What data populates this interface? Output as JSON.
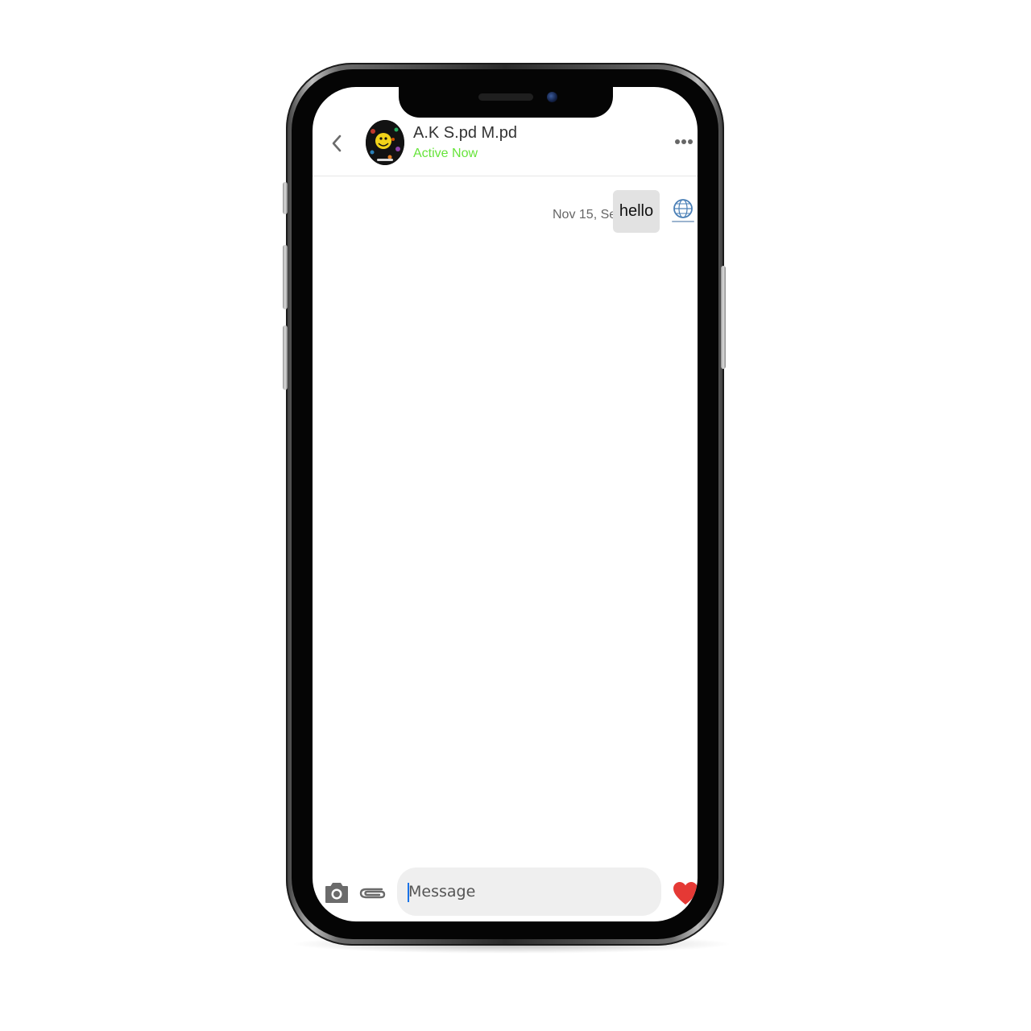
{
  "chat": {
    "contact_name": "A.K S.pd M.pd",
    "contact_status": "Active Now",
    "messages": [
      {
        "time": "Nov 15, Sel",
        "text": "hello",
        "from_self": true
      }
    ]
  },
  "composer": {
    "placeholder": "Message",
    "value": ""
  },
  "icons": {
    "back": "chevron-left-icon",
    "more": "more-horizontal-icon",
    "camera": "camera-icon",
    "attach": "paperclip-icon",
    "like": "heart-icon"
  },
  "colors": {
    "status_active": "#66e43a",
    "bubble_bg": "#e2e2e2",
    "input_bg": "#efefef",
    "heart": "#e53935",
    "icon_gray": "#666666"
  }
}
